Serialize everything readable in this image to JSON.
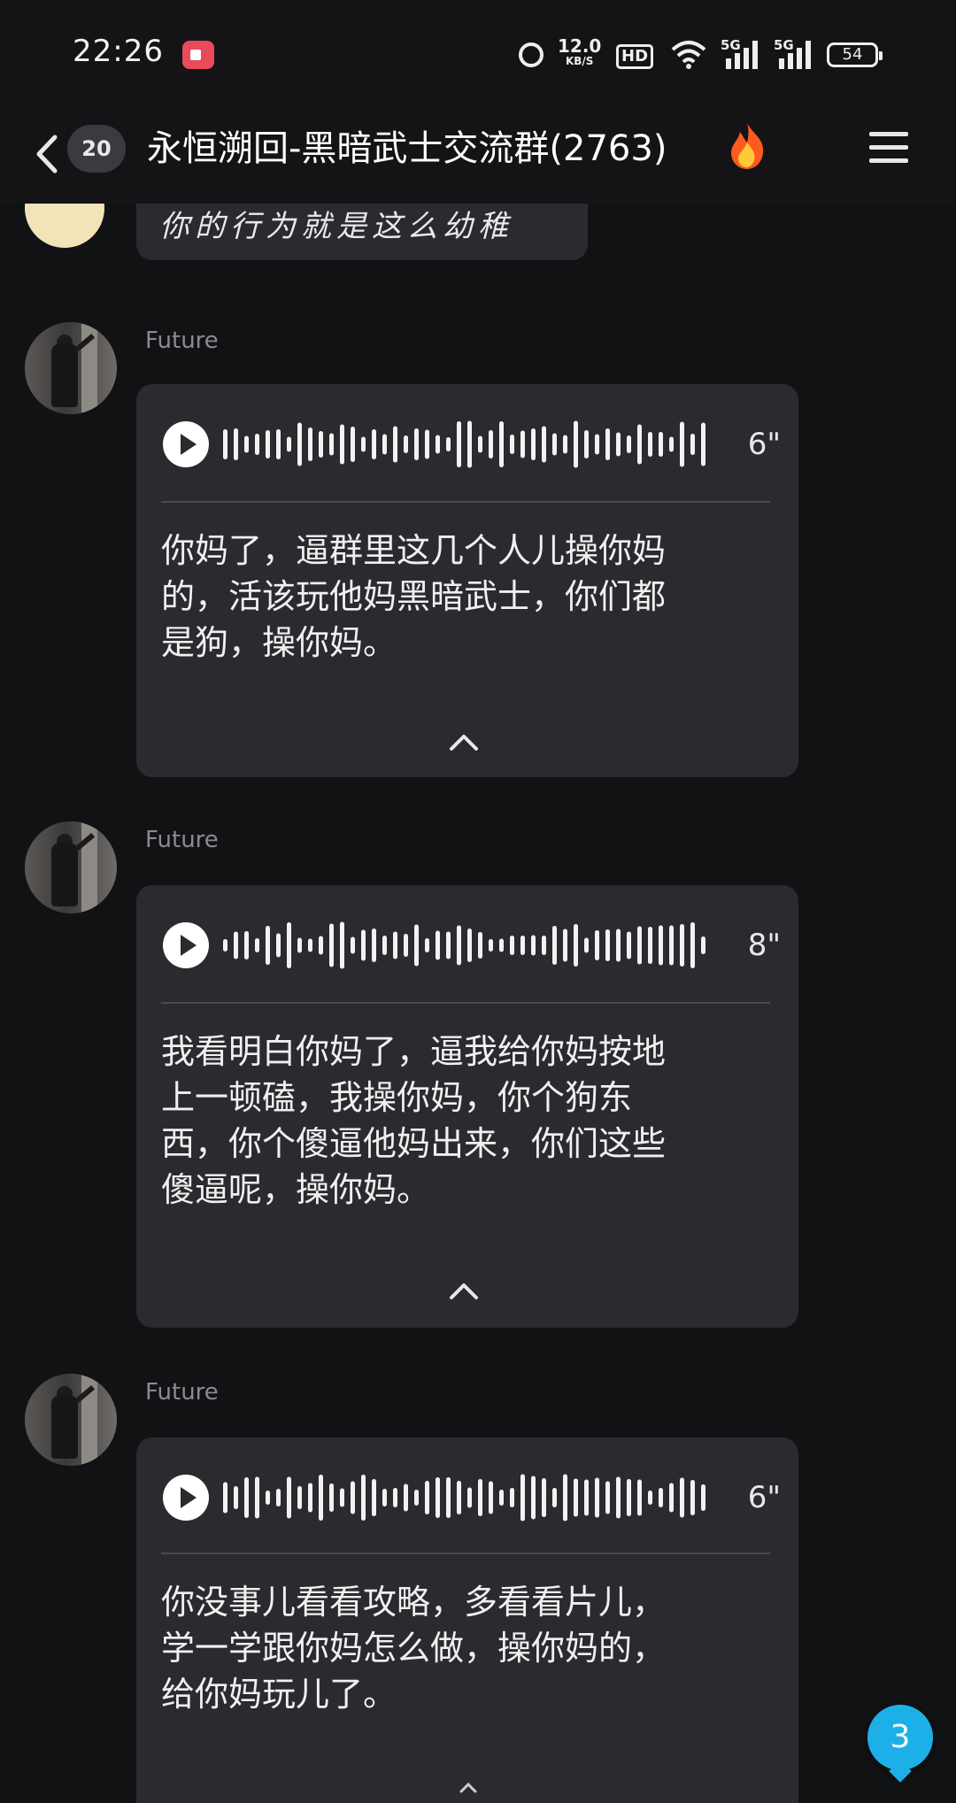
{
  "status_bar": {
    "time": "22:26",
    "net_speed": "12.0",
    "net_speed_unit": "KB/S",
    "hd_label": "HD",
    "signal1_label": "5G",
    "signal2_label": "5G",
    "battery": "54"
  },
  "header": {
    "unread_count": "20",
    "title": "永恒溯回-黑暗武士交流群(2763)"
  },
  "messages": [
    {
      "type": "text",
      "text": "你的行为就是这么幼稚"
    },
    {
      "type": "voice",
      "sender": "Future",
      "duration": "6\"",
      "transcript": "你妈了，逼群里这几个人儿操你妈\n的，活该玩他妈黑暗武士，你们都\n是狗，操你妈。"
    },
    {
      "type": "voice",
      "sender": "Future",
      "duration": "8\"",
      "transcript": "我看明白你妈了，逼我给你妈按地\n上一顿磕，我操你妈，你个狗东\n西，你个傻逼他妈出来，你们这些\n傻逼呢，操你妈。"
    },
    {
      "type": "voice",
      "sender": "Future",
      "duration": "6\"",
      "transcript": "你没事儿看看攻略，多看看片儿，\n学一学跟你妈怎么做，操你妈的，\n给你妈玩儿了。"
    }
  ],
  "floating_badge": "3",
  "colors": {
    "background": "#111214",
    "bubble": "#2a2b2f",
    "badge_blue": "#1db0e8"
  }
}
